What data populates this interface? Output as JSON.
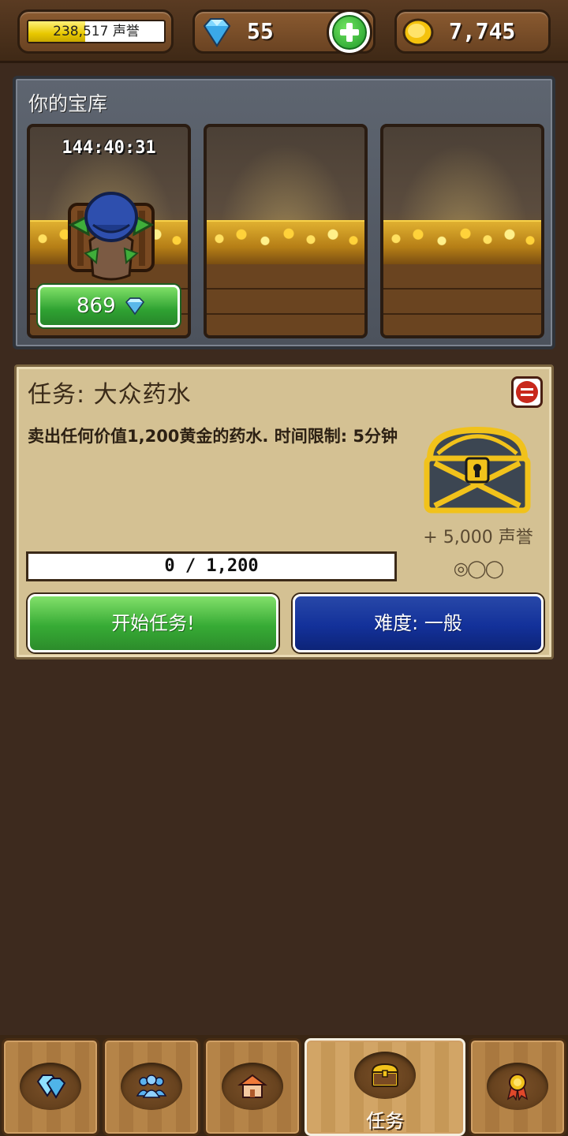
{
  "header": {
    "fame_text": "238,517 声誉",
    "fame_progress": 0.42,
    "gems": "55",
    "gold": "7,745"
  },
  "vault": {
    "title": "你的宝库",
    "slots": [
      {
        "timer": "144:40:31",
        "price": "869"
      },
      {},
      {}
    ]
  },
  "quest": {
    "title": "任务: 大众药水",
    "description": "卖出任何价值1,200黄金的药水. 时间限制: 5分钟",
    "reward": "+ 5,000 声誉",
    "rank_marks": "◎◯◯",
    "progress_text": "0 / 1,200",
    "progress": 0,
    "start_label": "开始任务!",
    "difficulty_label": "难度: 一般"
  },
  "nav": {
    "tabs": [
      {
        "icon": "gems-icon"
      },
      {
        "icon": "customers-icon"
      },
      {
        "icon": "shop-icon"
      },
      {
        "icon": "quest-chest-icon",
        "label": "任务",
        "active": true
      },
      {
        "icon": "achievement-medal-icon"
      }
    ]
  },
  "colors": {
    "background": "#3d2a1e",
    "green_button": "#37ab35",
    "blue_button": "#13319a",
    "fame_bar": "#e8c800"
  }
}
